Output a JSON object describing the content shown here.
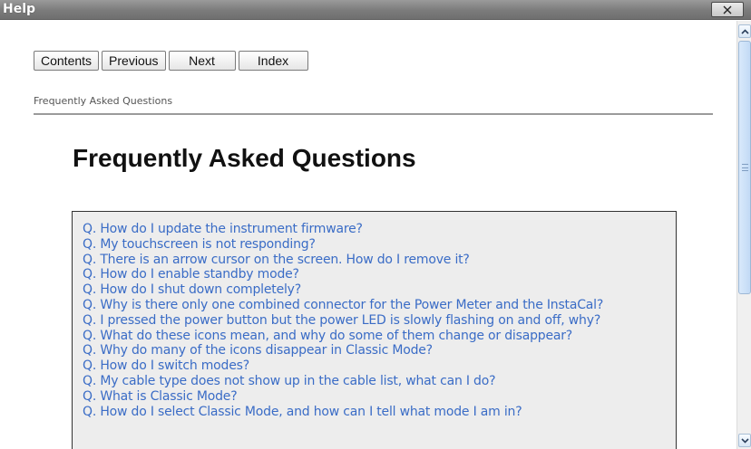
{
  "window": {
    "title": "Help"
  },
  "nav": {
    "contents": "Contents",
    "previous": "Previous",
    "next": "Next",
    "index": "Index"
  },
  "breadcrumb": "Frequently Asked Questions",
  "page_title": "Frequently Asked Questions",
  "faq": [
    "Q. How do I update the instrument firmware?",
    "Q. My touchscreen is not responding?",
    "Q. There is an arrow cursor on the screen. How do I remove it?",
    "Q. How do I enable standby mode?",
    "Q. How do I shut down completely?",
    "Q. Why is there only one combined connector for the Power Meter and the InstaCal?",
    "Q. I pressed the power button but the power LED is slowly flashing on and off, why?",
    "Q. What do these icons mean, and why do some of them change or disappear?",
    "Q. Why do many of the icons disappear in Classic Mode?",
    "Q. How do I switch modes?",
    "Q. My cable type does not show up in the cable list, what can I do?",
    "Q. What is Classic Mode?",
    "Q. How do I select Classic Mode, and how can I tell what mode I am in?"
  ],
  "colors": {
    "link": "#3a6cc6",
    "faq_background": "#ededed",
    "titlebar": "#7b7b7b"
  },
  "icons": {
    "close": "close-icon",
    "scroll_up": "chevron-up-icon",
    "scroll_down": "chevron-down-icon"
  }
}
